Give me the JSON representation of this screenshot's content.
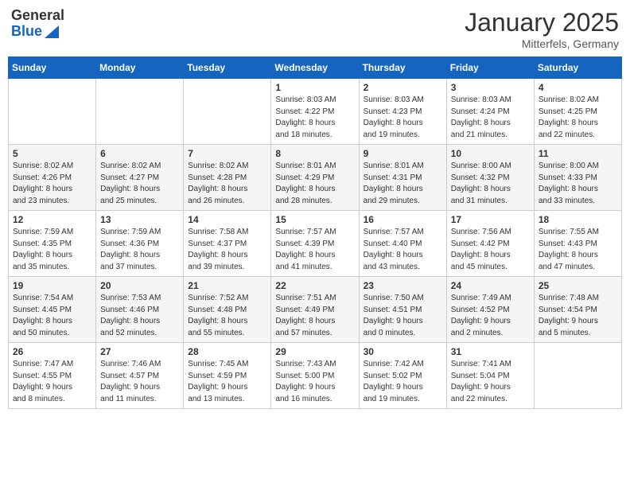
{
  "header": {
    "logo_general": "General",
    "logo_blue": "Blue",
    "month_title": "January 2025",
    "location": "Mitterfels, Germany"
  },
  "weekdays": [
    "Sunday",
    "Monday",
    "Tuesday",
    "Wednesday",
    "Thursday",
    "Friday",
    "Saturday"
  ],
  "weeks": [
    [
      {
        "day": "",
        "info": ""
      },
      {
        "day": "",
        "info": ""
      },
      {
        "day": "",
        "info": ""
      },
      {
        "day": "1",
        "info": "Sunrise: 8:03 AM\nSunset: 4:22 PM\nDaylight: 8 hours\nand 18 minutes."
      },
      {
        "day": "2",
        "info": "Sunrise: 8:03 AM\nSunset: 4:23 PM\nDaylight: 8 hours\nand 19 minutes."
      },
      {
        "day": "3",
        "info": "Sunrise: 8:03 AM\nSunset: 4:24 PM\nDaylight: 8 hours\nand 21 minutes."
      },
      {
        "day": "4",
        "info": "Sunrise: 8:02 AM\nSunset: 4:25 PM\nDaylight: 8 hours\nand 22 minutes."
      }
    ],
    [
      {
        "day": "5",
        "info": "Sunrise: 8:02 AM\nSunset: 4:26 PM\nDaylight: 8 hours\nand 23 minutes."
      },
      {
        "day": "6",
        "info": "Sunrise: 8:02 AM\nSunset: 4:27 PM\nDaylight: 8 hours\nand 25 minutes."
      },
      {
        "day": "7",
        "info": "Sunrise: 8:02 AM\nSunset: 4:28 PM\nDaylight: 8 hours\nand 26 minutes."
      },
      {
        "day": "8",
        "info": "Sunrise: 8:01 AM\nSunset: 4:29 PM\nDaylight: 8 hours\nand 28 minutes."
      },
      {
        "day": "9",
        "info": "Sunrise: 8:01 AM\nSunset: 4:31 PM\nDaylight: 8 hours\nand 29 minutes."
      },
      {
        "day": "10",
        "info": "Sunrise: 8:00 AM\nSunset: 4:32 PM\nDaylight: 8 hours\nand 31 minutes."
      },
      {
        "day": "11",
        "info": "Sunrise: 8:00 AM\nSunset: 4:33 PM\nDaylight: 8 hours\nand 33 minutes."
      }
    ],
    [
      {
        "day": "12",
        "info": "Sunrise: 7:59 AM\nSunset: 4:35 PM\nDaylight: 8 hours\nand 35 minutes."
      },
      {
        "day": "13",
        "info": "Sunrise: 7:59 AM\nSunset: 4:36 PM\nDaylight: 8 hours\nand 37 minutes."
      },
      {
        "day": "14",
        "info": "Sunrise: 7:58 AM\nSunset: 4:37 PM\nDaylight: 8 hours\nand 39 minutes."
      },
      {
        "day": "15",
        "info": "Sunrise: 7:57 AM\nSunset: 4:39 PM\nDaylight: 8 hours\nand 41 minutes."
      },
      {
        "day": "16",
        "info": "Sunrise: 7:57 AM\nSunset: 4:40 PM\nDaylight: 8 hours\nand 43 minutes."
      },
      {
        "day": "17",
        "info": "Sunrise: 7:56 AM\nSunset: 4:42 PM\nDaylight: 8 hours\nand 45 minutes."
      },
      {
        "day": "18",
        "info": "Sunrise: 7:55 AM\nSunset: 4:43 PM\nDaylight: 8 hours\nand 47 minutes."
      }
    ],
    [
      {
        "day": "19",
        "info": "Sunrise: 7:54 AM\nSunset: 4:45 PM\nDaylight: 8 hours\nand 50 minutes."
      },
      {
        "day": "20",
        "info": "Sunrise: 7:53 AM\nSunset: 4:46 PM\nDaylight: 8 hours\nand 52 minutes."
      },
      {
        "day": "21",
        "info": "Sunrise: 7:52 AM\nSunset: 4:48 PM\nDaylight: 8 hours\nand 55 minutes."
      },
      {
        "day": "22",
        "info": "Sunrise: 7:51 AM\nSunset: 4:49 PM\nDaylight: 8 hours\nand 57 minutes."
      },
      {
        "day": "23",
        "info": "Sunrise: 7:50 AM\nSunset: 4:51 PM\nDaylight: 9 hours\nand 0 minutes."
      },
      {
        "day": "24",
        "info": "Sunrise: 7:49 AM\nSunset: 4:52 PM\nDaylight: 9 hours\nand 2 minutes."
      },
      {
        "day": "25",
        "info": "Sunrise: 7:48 AM\nSunset: 4:54 PM\nDaylight: 9 hours\nand 5 minutes."
      }
    ],
    [
      {
        "day": "26",
        "info": "Sunrise: 7:47 AM\nSunset: 4:55 PM\nDaylight: 9 hours\nand 8 minutes."
      },
      {
        "day": "27",
        "info": "Sunrise: 7:46 AM\nSunset: 4:57 PM\nDaylight: 9 hours\nand 11 minutes."
      },
      {
        "day": "28",
        "info": "Sunrise: 7:45 AM\nSunset: 4:59 PM\nDaylight: 9 hours\nand 13 minutes."
      },
      {
        "day": "29",
        "info": "Sunrise: 7:43 AM\nSunset: 5:00 PM\nDaylight: 9 hours\nand 16 minutes."
      },
      {
        "day": "30",
        "info": "Sunrise: 7:42 AM\nSunset: 5:02 PM\nDaylight: 9 hours\nand 19 minutes."
      },
      {
        "day": "31",
        "info": "Sunrise: 7:41 AM\nSunset: 5:04 PM\nDaylight: 9 hours\nand 22 minutes."
      },
      {
        "day": "",
        "info": ""
      }
    ]
  ]
}
